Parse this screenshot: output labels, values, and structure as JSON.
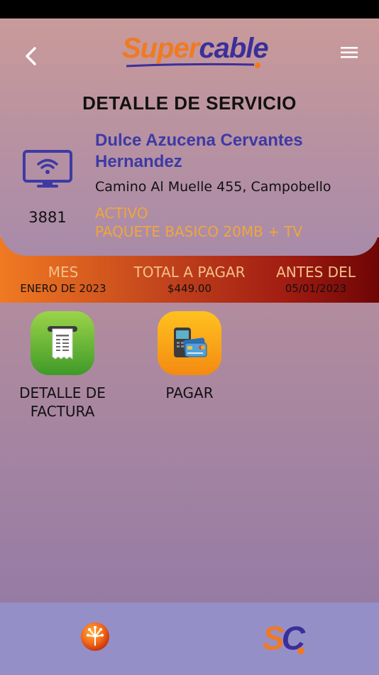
{
  "app": {
    "logo_part1": "Super",
    "logo_part2": "cable",
    "bottom_logo_text": "SC"
  },
  "header": {
    "title": "DETALLE DE SERVICIO"
  },
  "service": {
    "account_number": "3881",
    "client_name": "Dulce Azucena Cervantes Hernandez",
    "address": "Camino Al Muelle 455, Campobello",
    "status": "ACTIVO",
    "package": "PAQUETE BASICO 20MB + TV"
  },
  "billing": {
    "month_label": "MES",
    "month_value": "ENERO DE 2023",
    "total_label": "TOTAL A PAGAR",
    "total_value": "$449.00",
    "due_label": "ANTES DEL",
    "due_value": "05/01/2023"
  },
  "actions": [
    {
      "label": "DETALLE DE FACTURA",
      "icon": "receipt-icon"
    },
    {
      "label": "PAGAR",
      "icon": "payment-terminal-icon"
    }
  ],
  "icons": {
    "back": "chevron-left-icon",
    "menu": "hamburger-menu-icon",
    "tv": "smart-tv-icon",
    "bottom_left": "fiber-network-icon",
    "bottom_right": "supercable-sc-logo"
  },
  "colors": {
    "brand_orange": "#f07a22",
    "brand_blue": "#3b2f9a",
    "name_blue": "#3d3aa4",
    "status_orange": "#f0a63c",
    "bottom_bar": "#958fc8"
  }
}
